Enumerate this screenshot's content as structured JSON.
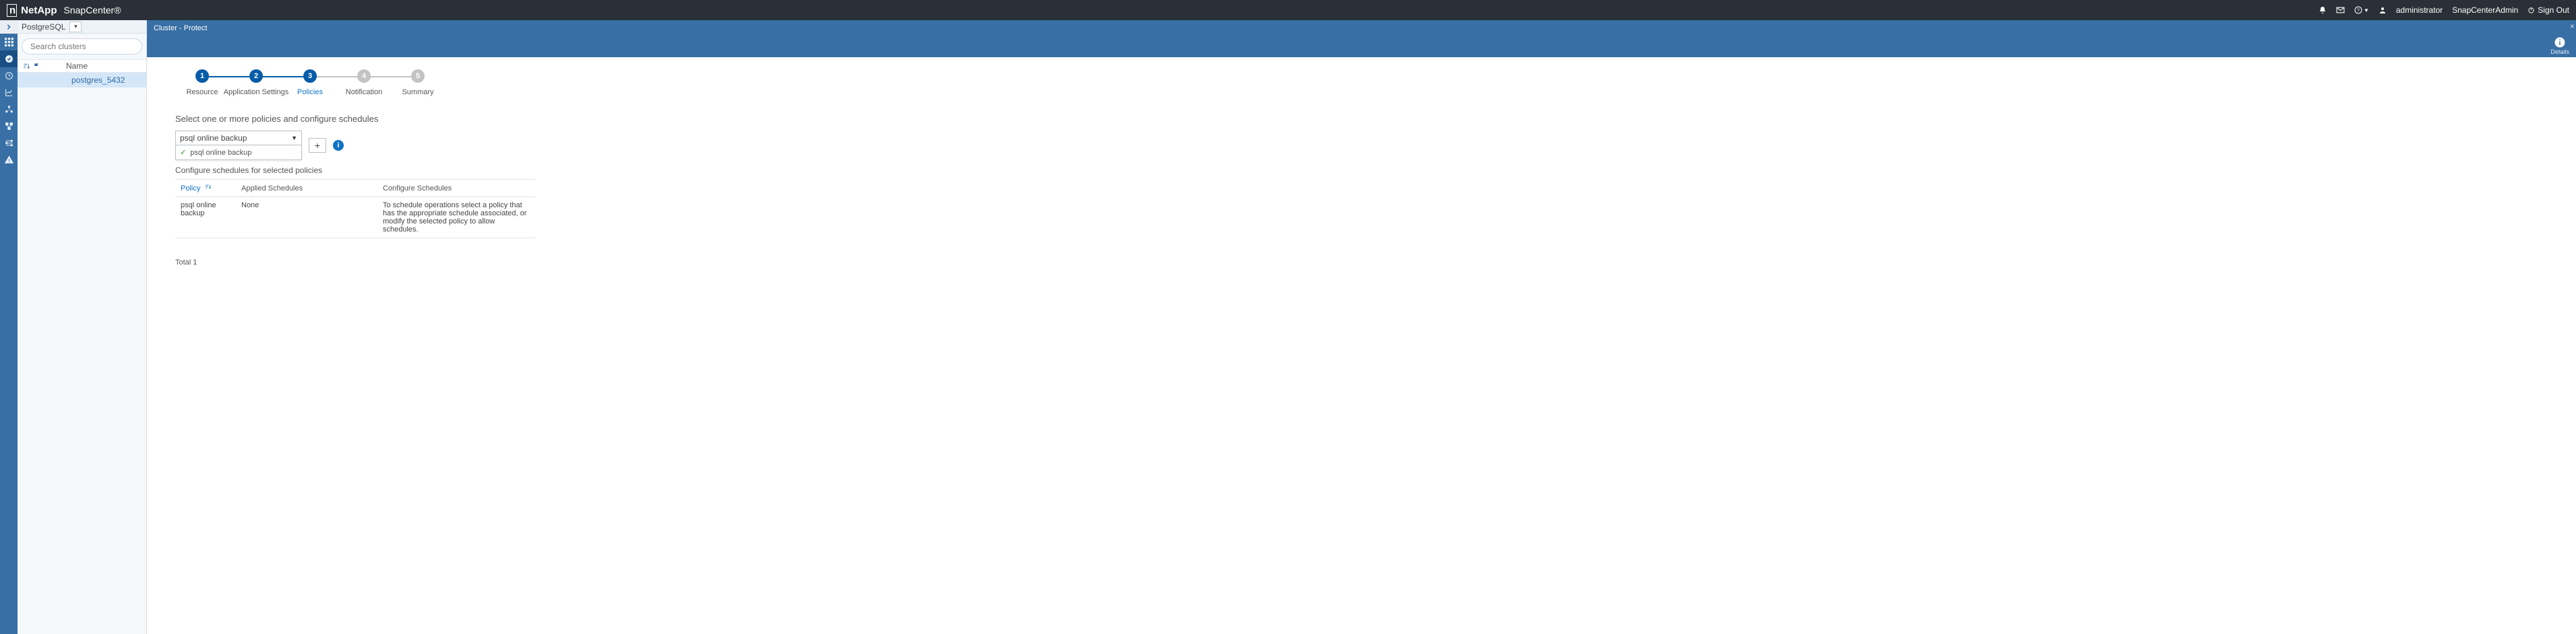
{
  "brand": {
    "vendor": "NetApp",
    "app": "SnapCenter®"
  },
  "topnav": {
    "user_label": "administrator",
    "role_label": "SnapCenterAdmin",
    "signout_label": "Sign Out"
  },
  "sidepanel": {
    "context_label": "PostgreSQL",
    "search_placeholder": "Search clusters",
    "col_name": "Name",
    "items": [
      {
        "name": "postgres_5432",
        "selected": true
      }
    ]
  },
  "content_header": {
    "breadcrumb": "Cluster - Protect",
    "details_label": "Details",
    "close_glyph": "×"
  },
  "wizard": {
    "steps": [
      {
        "num": "1",
        "label": "Resource",
        "state": "done"
      },
      {
        "num": "2",
        "label": "Application Settings",
        "state": "done"
      },
      {
        "num": "3",
        "label": "Policies",
        "state": "active"
      },
      {
        "num": "4",
        "label": "Notification",
        "state": "pending"
      },
      {
        "num": "5",
        "label": "Summary",
        "state": "pending"
      }
    ]
  },
  "policies": {
    "section_title": "Select one or more policies and configure schedules",
    "dropdown_selected": "psql online backup",
    "dropdown_option": "psql online backup",
    "add_glyph": "+",
    "configure_title": "Configure schedules for selected policies",
    "table": {
      "col_policy": "Policy",
      "col_applied": "Applied Schedules",
      "col_configure": "Configure Schedules",
      "rows": [
        {
          "policy": "psql online backup",
          "applied": "None",
          "configure": "To schedule operations select a policy that has the appropriate schedule associated, or modify the selected policy to allow schedules."
        }
      ]
    },
    "total_label": "Total 1"
  }
}
